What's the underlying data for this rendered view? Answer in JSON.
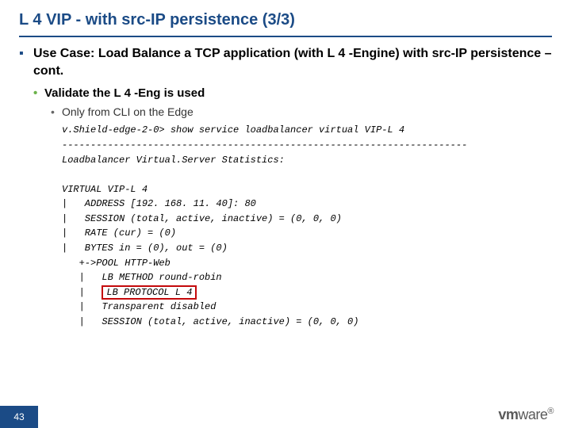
{
  "title": "L 4 VIP - with src-IP persistence (3/3)",
  "bullets": {
    "l1": "Use Case: Load Balance a TCP application (with L 4 -Engine) with src-IP persistence – cont.",
    "l2": "Validate the L 4 -Eng is used",
    "l3": "Only from CLI on the Edge"
  },
  "cli": {
    "l01": "v.Shield-edge-2-0> show service loadbalancer virtual VIP-L 4",
    "l02": "-----------------------------------------------------------------------",
    "l03": "Loadbalancer Virtual.Server Statistics:",
    "l04": "",
    "l05": "VIRTUAL VIP-L 4",
    "l06": "|   ADDRESS [192. 168. 11. 40]: 80",
    "l07": "|   SESSION (total, active, inactive) = (0, 0, 0)",
    "l08": "|   RATE (cur) = (0)",
    "l09": "|   BYTES in = (0), out = (0)",
    "l10": "   +->POOL HTTP-Web",
    "l11": "   |   LB METHOD round-robin",
    "l12pre": "   |   ",
    "l12hl": "LB PROTOCOL L 4",
    "l13": "   |   Transparent disabled",
    "l14": "   |   SESSION (total, active, inactive) = (0, 0, 0)"
  },
  "page": "43",
  "vendor": {
    "a": "vm",
    "b": "ware",
    "r": "®"
  }
}
